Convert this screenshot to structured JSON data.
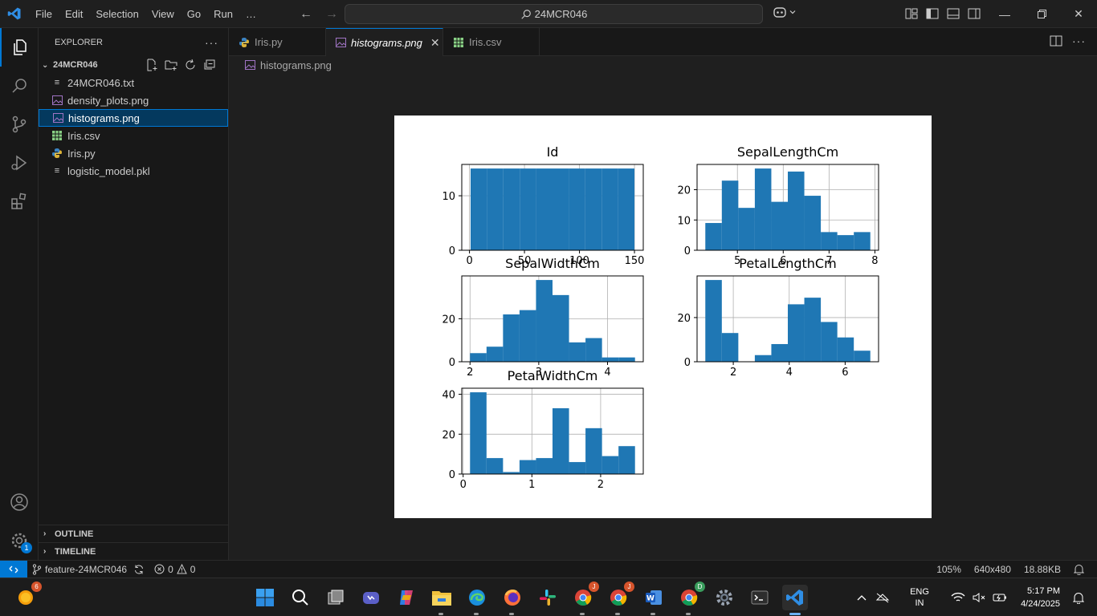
{
  "menu": [
    "File",
    "Edit",
    "Selection",
    "View",
    "Go",
    "Run",
    "…"
  ],
  "command_center": "24MCR046",
  "sidebar": {
    "title": "EXPLORER",
    "folder": "24MCR046",
    "files": [
      {
        "name": "24MCR046.txt",
        "type": "text"
      },
      {
        "name": "density_plots.png",
        "type": "image"
      },
      {
        "name": "histograms.png",
        "type": "image",
        "selected": true
      },
      {
        "name": "Iris.csv",
        "type": "csv"
      },
      {
        "name": "Iris.py",
        "type": "python"
      },
      {
        "name": "logistic_model.pkl",
        "type": "text"
      }
    ],
    "outline": "OUTLINE",
    "timeline": "TIMELINE"
  },
  "tabs": [
    {
      "label": "Iris.py",
      "icon": "python-icon"
    },
    {
      "label": "histograms.png",
      "icon": "image-icon",
      "active": true
    },
    {
      "label": "Iris.csv",
      "icon": "csv-icon"
    }
  ],
  "breadcrumb": "histograms.png",
  "statusbar": {
    "branch": "feature-24MCR046",
    "errors": "0",
    "warnings": "0",
    "zoom": "105%",
    "dimensions": "640x480",
    "size": "18.88KB"
  },
  "activity_badge": "1",
  "taskbar": {
    "lang_top": "ENG",
    "lang_bottom": "IN",
    "time": "5:17 PM",
    "date": "4/24/2025",
    "weather_badge": "6"
  },
  "colors": {
    "accent": "#0078d4",
    "bar": "#1f77b4"
  },
  "chart_data": [
    {
      "type": "bar",
      "title": "Id",
      "bins": 10,
      "bin_edges": [
        1,
        150
      ],
      "values": [
        15,
        15,
        15,
        15,
        15,
        15,
        15,
        15,
        15,
        15
      ],
      "xticks": [
        "0",
        "50",
        "100",
        "150"
      ],
      "yticks": [
        "0",
        "10"
      ],
      "xlim": [
        -7,
        158
      ],
      "ylim": [
        0,
        15.75
      ],
      "grid": true
    },
    {
      "type": "bar",
      "title": "SepalLengthCm",
      "bins": 10,
      "bin_edges": [
        4.3,
        7.9
      ],
      "values": [
        9,
        23,
        14,
        27,
        16,
        26,
        18,
        6,
        5,
        6
      ],
      "xticks": [
        "5",
        "6",
        "7",
        "8"
      ],
      "yticks": [
        "0",
        "10",
        "20"
      ],
      "xlim": [
        4.12,
        8.08
      ],
      "ylim": [
        0,
        28.35
      ],
      "grid": true
    },
    {
      "type": "bar",
      "title": "SepalWidthCm",
      "bins": 10,
      "bin_edges": [
        2.0,
        4.4
      ],
      "values": [
        4,
        7,
        22,
        24,
        38,
        31,
        9,
        11,
        2,
        2
      ],
      "xticks": [
        "2",
        "3",
        "4"
      ],
      "yticks": [
        "0",
        "20"
      ],
      "xlim": [
        1.88,
        4.52
      ],
      "ylim": [
        0,
        39.9
      ],
      "grid": true
    },
    {
      "type": "bar",
      "title": "PetalLengthCm",
      "bins": 10,
      "bin_edges": [
        1.0,
        6.9
      ],
      "values": [
        37,
        13,
        0,
        3,
        8,
        26,
        29,
        18,
        11,
        5
      ],
      "xticks": [
        "2",
        "4",
        "6"
      ],
      "yticks": [
        "0",
        "20"
      ],
      "xlim": [
        0.705,
        7.195
      ],
      "ylim": [
        0,
        38.85
      ],
      "grid": true
    },
    {
      "type": "bar",
      "title": "PetalWidthCm",
      "bins": 10,
      "bin_edges": [
        0.1,
        2.5
      ],
      "values": [
        41,
        8,
        1,
        7,
        8,
        33,
        6,
        23,
        9,
        14
      ],
      "xticks": [
        "0",
        "1",
        "2"
      ],
      "yticks": [
        "0",
        "20",
        "40"
      ],
      "xlim": [
        -0.02,
        2.62
      ],
      "ylim": [
        0,
        43.05
      ],
      "grid": true
    }
  ]
}
